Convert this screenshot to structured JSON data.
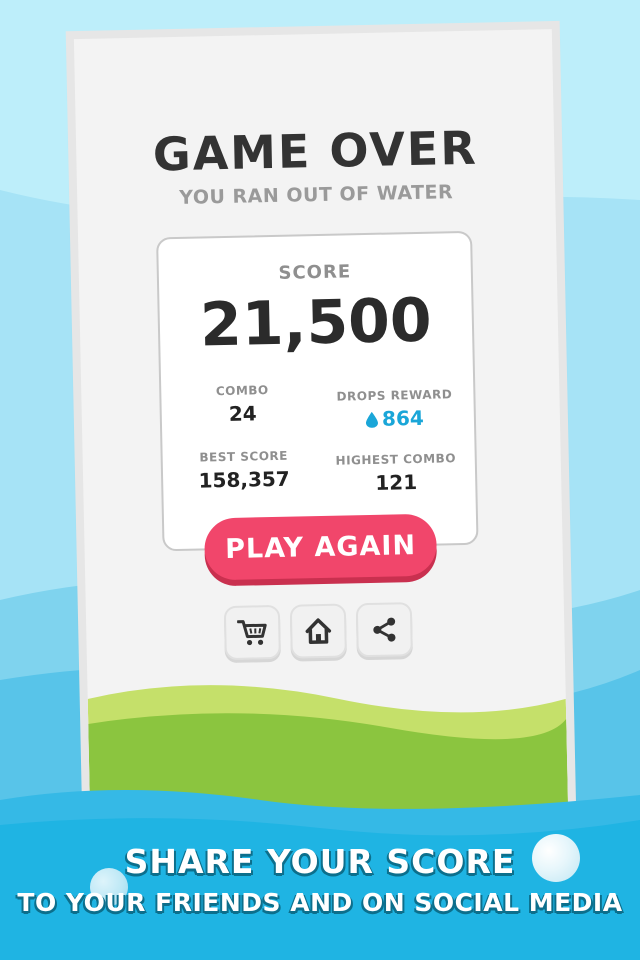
{
  "game_over": {
    "title": "GAME OVER",
    "subtitle": "YOU RAN OUT OF WATER"
  },
  "score_panel": {
    "score_label": "SCORE",
    "score_value": "21,500",
    "combo_label": "COMBO",
    "combo_value": "24",
    "drops_reward_label": "DROPS REWARD",
    "drops_reward_value": "864",
    "best_score_label": "BEST SCORE",
    "best_score_value": "158,357",
    "highest_combo_label": "HIGHEST COMBO",
    "highest_combo_value": "121"
  },
  "buttons": {
    "play_again_label": "PLAY AGAIN",
    "shop_icon": "cart-icon",
    "home_icon": "home-icon",
    "share_icon": "share-icon"
  },
  "banner": {
    "line1": "SHARE YOUR SCORE",
    "line2": "TO YOUR FRIENDS AND ON SOCIAL MEDIA"
  },
  "colors": {
    "play_button": "#f1466b",
    "drops_accent": "#1aa6d8",
    "grass": "#8bc53f",
    "sea": "#1fb4e3"
  }
}
